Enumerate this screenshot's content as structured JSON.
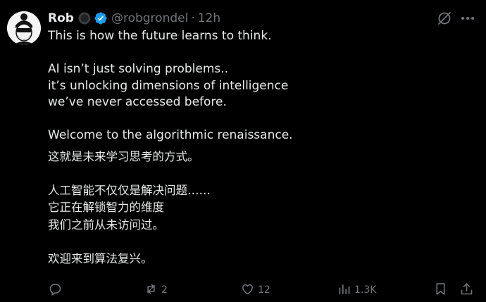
{
  "tweet": {
    "display_name": "Rob",
    "handle": "@robgrondel",
    "separator": "·",
    "time": "12h",
    "body": {
      "line1": "This is how the future learns to think.",
      "line2": "AI isn’t just solving problems..\nit’s unlocking dimensions of intelligence\nwe’ve never accessed before.",
      "line3": "Welcome to the algorithmic renaissance.",
      "zh1": "这就是未来学习思考的方式。",
      "zh2": "人工智能不仅仅是解决问题……\n它正在解锁智力的维度\n我们之前从未访问过。",
      "zh3": "欢迎来到算法复兴。"
    },
    "actions": {
      "replies": "",
      "reposts": "2",
      "likes": "12",
      "views": "1.3K"
    }
  },
  "colors": {
    "background": "#000000",
    "text": "#e7e9ea",
    "muted": "#71767b",
    "verified": "#1d9bf0"
  },
  "icons": {
    "avatar": "avatar-image",
    "badge": "affiliate-badge-icon",
    "verified": "verified-checkmark-icon",
    "grok": "grok-icon",
    "more": "more-dots-icon",
    "reply": "reply-icon",
    "repost": "repost-icon",
    "like": "heart-icon",
    "views": "views-chart-icon",
    "bookmark": "bookmark-icon",
    "share": "share-icon"
  }
}
